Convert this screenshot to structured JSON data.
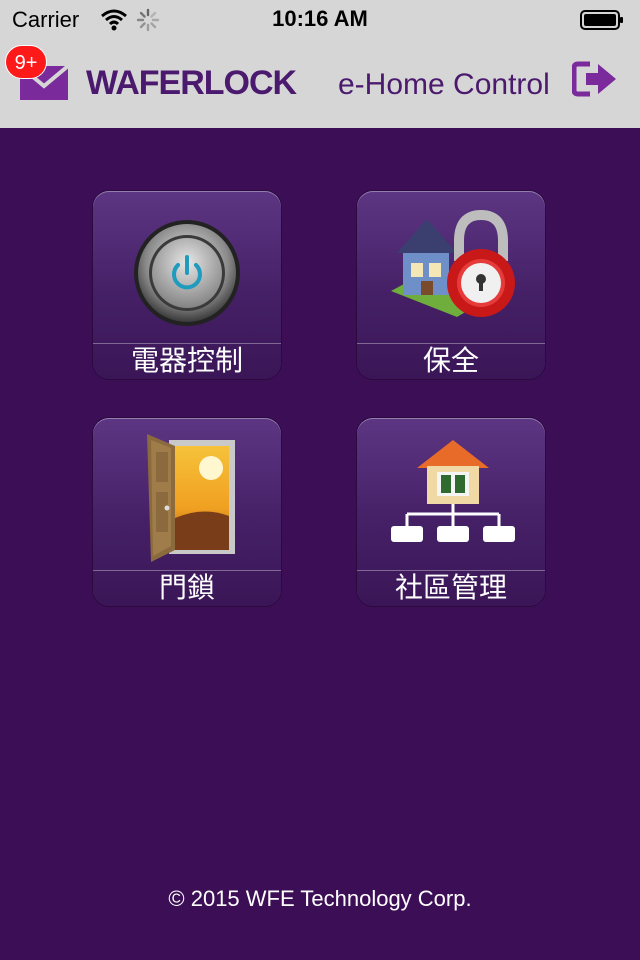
{
  "status_bar": {
    "carrier": "Carrier",
    "time": "10:16 AM"
  },
  "header": {
    "badge_count": "9+",
    "brand": "WAFERLOCK",
    "subtitle": "e-Home Control",
    "icons": [
      "mail-icon",
      "logout-icon"
    ],
    "accent_color": "#7a2a9a"
  },
  "tiles": [
    {
      "label": "電器控制",
      "icon": "power-button-icon"
    },
    {
      "label": "保全",
      "icon": "house-lock-icon"
    },
    {
      "label": "門鎖",
      "icon": "open-door-icon"
    },
    {
      "label": "社區管理",
      "icon": "community-tree-icon"
    }
  ],
  "footer": {
    "copyright": "© 2015 WFE Technology Corp."
  },
  "colors": {
    "background": "#3b0e56",
    "header_bg": "#d6d6d6",
    "badge": "#ff1a1a"
  }
}
